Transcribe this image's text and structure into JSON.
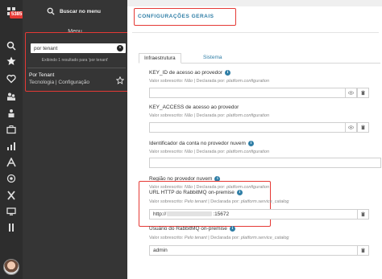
{
  "rail": {
    "badge": "5385",
    "icons": [
      "grid-icon",
      "search-icon",
      "star-icon",
      "heart-icon",
      "people-icon",
      "briefcase-icon",
      "chart-icon",
      "font-icon",
      "target-icon",
      "close-x-icon",
      "monitor-icon",
      "info-icon"
    ]
  },
  "menu": {
    "search_label": "Buscar no menu",
    "title": "Menu",
    "search_value": "por tenant",
    "result_count": "Exibindo 1 resultado para 'por tenant'",
    "results": [
      {
        "title": "Por Tenant",
        "path": "Tecnologia | Configuração"
      }
    ]
  },
  "main": {
    "section_title": "CONFIGURAÇÕES GERAIS",
    "tabs": [
      {
        "label": "Infraestrutura",
        "active": true
      },
      {
        "label": "Sistema",
        "active": false
      }
    ],
    "fields": [
      {
        "label": "KEY_ID de acesso ao provedor",
        "overwritten_label": "Valor sobrescrito:",
        "overwritten_value": "Não",
        "declared_label": "| Declarada por:",
        "declared_value": "platform.configuration",
        "value": ""
      },
      {
        "label": "KEY_ACCESS de acesso ao provedor",
        "overwritten_label": "Valor sobrescrito:",
        "overwritten_value": "Não",
        "declared_label": "| Declarada por:",
        "declared_value": "platform.configuration",
        "value": ""
      },
      {
        "label": "Identificador da conta no provedor nuvem",
        "overwritten_label": "Valor sobrescrito:",
        "overwritten_value": "Não",
        "declared_label": "| Declarada por:",
        "declared_value": "platform.configuration",
        "value": ""
      },
      {
        "label": "Região no provedor nuvem",
        "overwritten_label": "Valor sobrescrito:",
        "overwritten_value": "Não",
        "declared_label": "| Declarada por:",
        "declared_value": "platform.configuration",
        "value": ""
      },
      {
        "label": "URL HTTP do RabbitMQ on-premise",
        "overwritten_label": "Valor sobrescrito:",
        "overwritten_value": "Pelo tenant",
        "declared_label": "| Declarada por:",
        "declared_value": "platform.service_catalog",
        "value_prefix": "http://",
        "value_suffix": ":15672"
      },
      {
        "label": "Usuário do RabbitMQ on-premise",
        "overwritten_label": "Valor sobrescrito:",
        "overwritten_value": "Pelo tenant",
        "declared_label": "| Declarada por:",
        "declared_value": "platform.service_catalog",
        "value": "admin"
      }
    ]
  },
  "colors": {
    "accent": "#2f7ea6",
    "highlight": "#e53935",
    "rail_bg": "#2d2d2d",
    "menu_bg": "#353535"
  }
}
